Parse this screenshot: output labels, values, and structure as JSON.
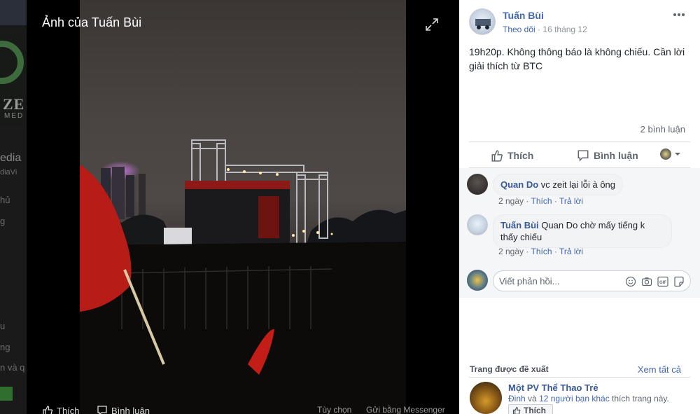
{
  "background_page": {
    "logo_text": "ZE",
    "logo_subtext": "MED",
    "fragments": [
      "edia",
      "diaVi",
      "hủ",
      "g",
      "u",
      "ng",
      "n và q"
    ]
  },
  "photo_viewer": {
    "title": "Ảnh của Tuấn Bùi",
    "footer": {
      "like": "Thích",
      "comment": "Bình luận",
      "options": "Tùy chọn",
      "send_messenger": "Gửi bằng Messenger"
    }
  },
  "post": {
    "author": "Tuấn Bùi",
    "follow_label": "Theo dõi",
    "date": "16 tháng 12",
    "text": "19h20p. Không thông báo là không chiếu. Cần lời giải thích từ BTC",
    "comment_count": "2 bình luận",
    "actions": {
      "like": "Thích",
      "comment": "Bình luận"
    }
  },
  "comments": [
    {
      "author": "Quan Do",
      "text": "vc zeit lại lỗi à ông",
      "time": "2 ngày",
      "like": "Thích",
      "reply": "Trả lời"
    },
    {
      "author": "Tuấn Bùi",
      "text": "Quan Do chờ mấy tiếng k thấy chiếu",
      "time": "2 ngày",
      "like": "Thích",
      "reply": "Trả lời"
    }
  ],
  "reply_input": {
    "placeholder": "Viết phản hồi..."
  },
  "suggested": {
    "title": "Trang được đề xuất",
    "see_all": "Xem tất cả",
    "page_name": "Một PV Thể Thao Trẻ",
    "liked_by_prefix": "Đinh",
    "liked_by_joiner": "và",
    "liked_by_friends": "12 người bạn khác",
    "liked_by_suffix": "thích trang này.",
    "like_button": "Thích"
  },
  "colors": {
    "brand": "#4267b2",
    "link": "#385898",
    "text": "#1d2129",
    "muted": "#606770"
  },
  "icons": [
    "expand-icon",
    "more-icon",
    "thumbs-up-icon",
    "comment-icon",
    "chevron-down-icon",
    "emoji-icon",
    "camera-icon",
    "gif-icon",
    "sticker-icon"
  ]
}
